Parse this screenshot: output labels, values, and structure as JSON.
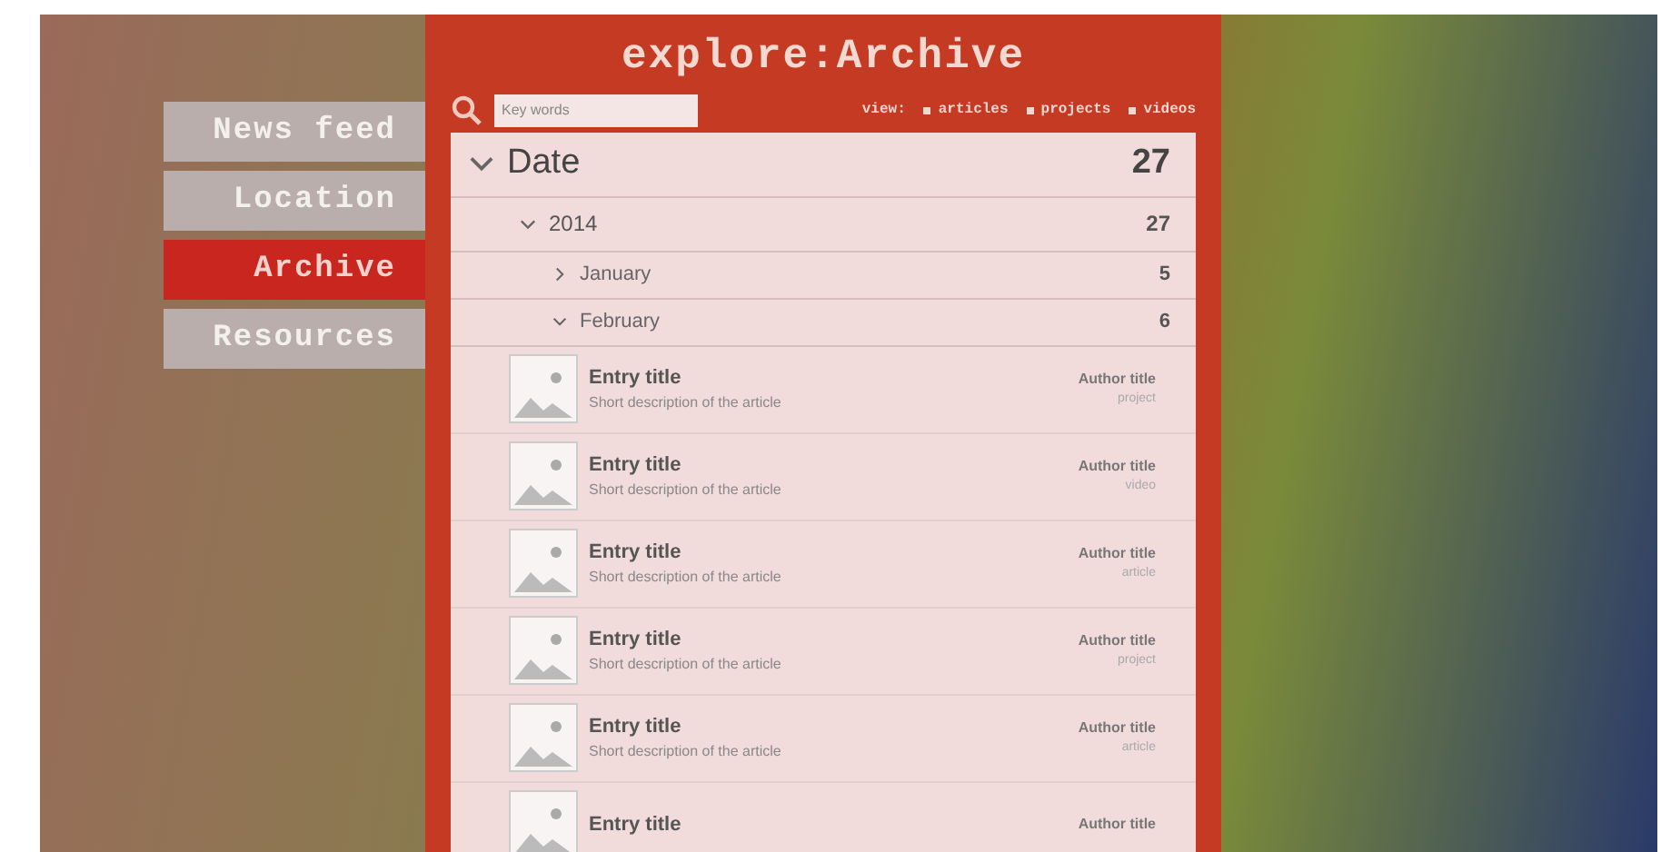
{
  "sidebar": {
    "items": [
      {
        "label": "News feed",
        "selected": false
      },
      {
        "label": "Location",
        "selected": false
      },
      {
        "label": "Archive",
        "selected": true
      },
      {
        "label": "Resources",
        "selected": false
      }
    ]
  },
  "header": {
    "title": "explore:Archive"
  },
  "search": {
    "placeholder": "Key words"
  },
  "view": {
    "label": "view:",
    "options": [
      "articles",
      "projects",
      "videos"
    ]
  },
  "tree": [
    {
      "label": "Date",
      "count": "27",
      "expanded": true,
      "children": [
        {
          "label": "2014",
          "count": "27",
          "expanded": true,
          "children": [
            {
              "label": "January",
              "count": "5",
              "expanded": false
            },
            {
              "label": "February",
              "count": "6",
              "expanded": true
            }
          ]
        }
      ]
    }
  ],
  "entries": [
    {
      "title": "Entry title",
      "description": "Short description of the article",
      "author": "Author title",
      "type": "project"
    },
    {
      "title": "Entry title",
      "description": "Short description of the article",
      "author": "Author title",
      "type": "video"
    },
    {
      "title": "Entry title",
      "description": "Short description of the article",
      "author": "Author title",
      "type": "article"
    },
    {
      "title": "Entry title",
      "description": "Short description of the article",
      "author": "Author title",
      "type": "project"
    },
    {
      "title": "Entry title",
      "description": "Short description of the article",
      "author": "Author title",
      "type": "article"
    },
    {
      "title": "Entry title",
      "author": "Author title"
    }
  ]
}
